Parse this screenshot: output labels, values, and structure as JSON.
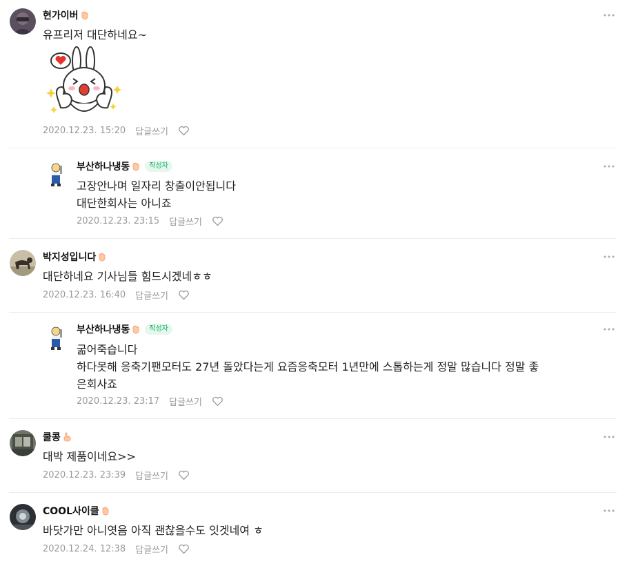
{
  "comments": [
    {
      "author": "현가이버",
      "text": [
        "유프리저 대단하네요~"
      ],
      "date": "2020.12.23. 15:20",
      "reply": "답글쓰기",
      "badge": ""
    },
    {
      "author": "부산하나냉동",
      "text": [
        "고장안나며 일자리 창출이안됩니다",
        "대단한회사는 아니죠"
      ],
      "date": "2020.12.23. 23:15",
      "reply": "답글쓰기",
      "badge": "작성자"
    },
    {
      "author": "박지성입니다",
      "text": [
        "대단하네요 기사님들 힘드시겠네ㅎㅎ"
      ],
      "date": "2020.12.23. 16:40",
      "reply": "답글쓰기",
      "badge": ""
    },
    {
      "author": "부산하나냉동",
      "text": [
        "굶어죽습니다",
        "하다못해 응축기팬모터도 27년 돌았다는게 요즘응축모터 1년만에 스톱하는게 정말 많습니다 정말 좋",
        "은회사죠"
      ],
      "date": "2020.12.23. 23:17",
      "reply": "답글쓰기",
      "badge": "작성자"
    },
    {
      "author": "쿨콩",
      "text": [
        "대박 제품이네요>>"
      ],
      "date": "2020.12.23. 23:39",
      "reply": "답글쓰기",
      "badge": ""
    },
    {
      "author": "COOL사이클",
      "text": [
        "바닷가만 아니엿음 아직 괜찮을수도 잇겟네여 ㅎ"
      ],
      "date": "2020.12.24. 12:38",
      "reply": "답글쓰기",
      "badge": ""
    }
  ],
  "colors": {
    "badge_text": "#10b36a",
    "badge_bg": "#e6f7ee",
    "meta": "#999999",
    "divider": "#ececec"
  },
  "icons": {
    "hand": "hand-wave-icon",
    "heart": "heart-outline-icon",
    "more": "more-dots-icon"
  }
}
